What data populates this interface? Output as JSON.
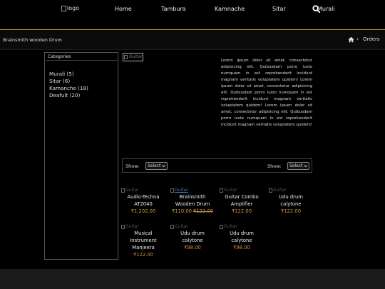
{
  "header": {
    "logo_alt": "logo",
    "nav": [
      "Home",
      "Tambura",
      "Kamnache",
      "Sitar",
      "Murali"
    ]
  },
  "breadcrumb": {
    "title": "Brainsmith wooden Drum",
    "current": "Orders"
  },
  "sidebar": {
    "heading": "Categories",
    "items": [
      "Murali (5)",
      "Sitar (6)",
      "Kamanche (18)",
      "Deafult (20)"
    ]
  },
  "product_detail": {
    "image_alt": "Guitar",
    "description": "Lorem ipsum dolor sit amet, consectetur adipisicing elit. Quibusdam porro iusto numquam in est reprehenderit incidunt magnam veritatis voluptatem quidem! Lorem ipsum dolor sit amet, consectetur adipisicing elit. Quibusdam porro iusto numquam in est reprehenderit incidunt magnam veritatis voluptatem quidem! Lorem ipsum dolor sit amet, consectetur adipisicing elit. Quibusdam porro iusto numquam in est reprehenderit incidunt magnam veritatis voluptatem quidem!"
  },
  "filters": {
    "show_label_1": "Show:",
    "select_1": "Select",
    "show_label_2": "Show:",
    "select_2": "Select"
  },
  "products": [
    {
      "image_alt": "Guitar",
      "name_1": "Audio-Techna",
      "name_2": "AT2040",
      "price": "₹1,202.00",
      "old_price": ""
    },
    {
      "image_alt": "Guitar",
      "name_1": "Brainsmith",
      "name_2": "Wooden Drum",
      "price": "₹110.00",
      "old_price": "₹122.00"
    },
    {
      "image_alt": "Guitar",
      "name_1": "Guitar Combo",
      "name_2": "Amplifier",
      "price": "₹122.00",
      "old_price": ""
    },
    {
      "image_alt": "Guitar",
      "name_1": "Udu drum",
      "name_2": "calytone",
      "price": "₹122.00",
      "old_price": ""
    },
    {
      "image_alt": "Guitar",
      "name_1": "Musical",
      "name_2": "Instrument",
      "name_3": "Manjeera",
      "price": "₹122.00",
      "old_price": ""
    },
    {
      "image_alt": "Guitar",
      "name_1": "Udu drum",
      "name_2": "calytone",
      "price": "₹98.00",
      "old_price": ""
    },
    {
      "image_alt": "Guitar",
      "name_1": "Udu drum",
      "name_2": "calytone",
      "price": "₹98.00",
      "old_price": ""
    }
  ],
  "colors": {
    "accent_line": "#b8942f",
    "price": "#c8923a",
    "link": "#4a78c8"
  },
  "icons": [
    "search-icon",
    "home-icon",
    "chevron-right-icon",
    "chevron-down-icon",
    "broken-image-icon"
  ]
}
